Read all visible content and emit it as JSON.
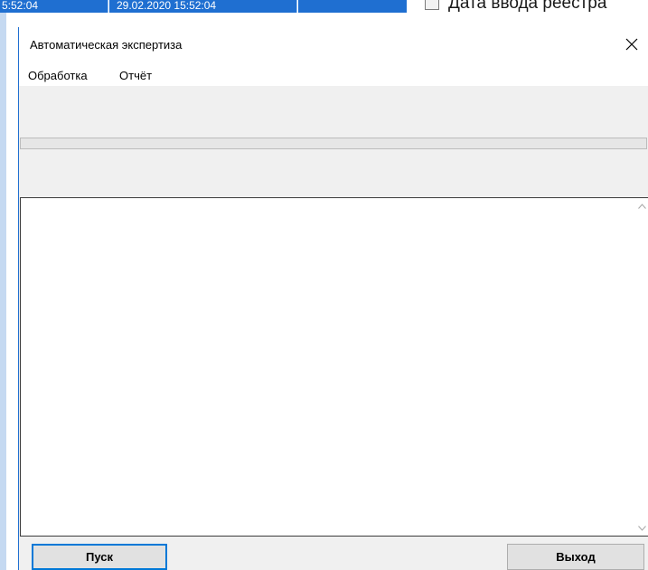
{
  "background_window": {
    "cell1_text": "5:52:04",
    "cell2_text": "29.02.2020 15:52:04",
    "column_header": "Дата ввода реестра",
    "accent_color": "#1f6fd1"
  },
  "dialog": {
    "title": "Автоматическая экспертиза",
    "close_icon": "close-icon",
    "menu": [
      "Обработка",
      "Отчёт"
    ],
    "progress": {
      "value": 0
    },
    "log_text": "",
    "scroll_up_icon": "chevron-up-icon",
    "scroll_down_icon": "chevron-down-icon",
    "buttons": {
      "start_label": "Пуск",
      "exit_label": "Выход"
    },
    "focus_color": "#0078d7"
  }
}
